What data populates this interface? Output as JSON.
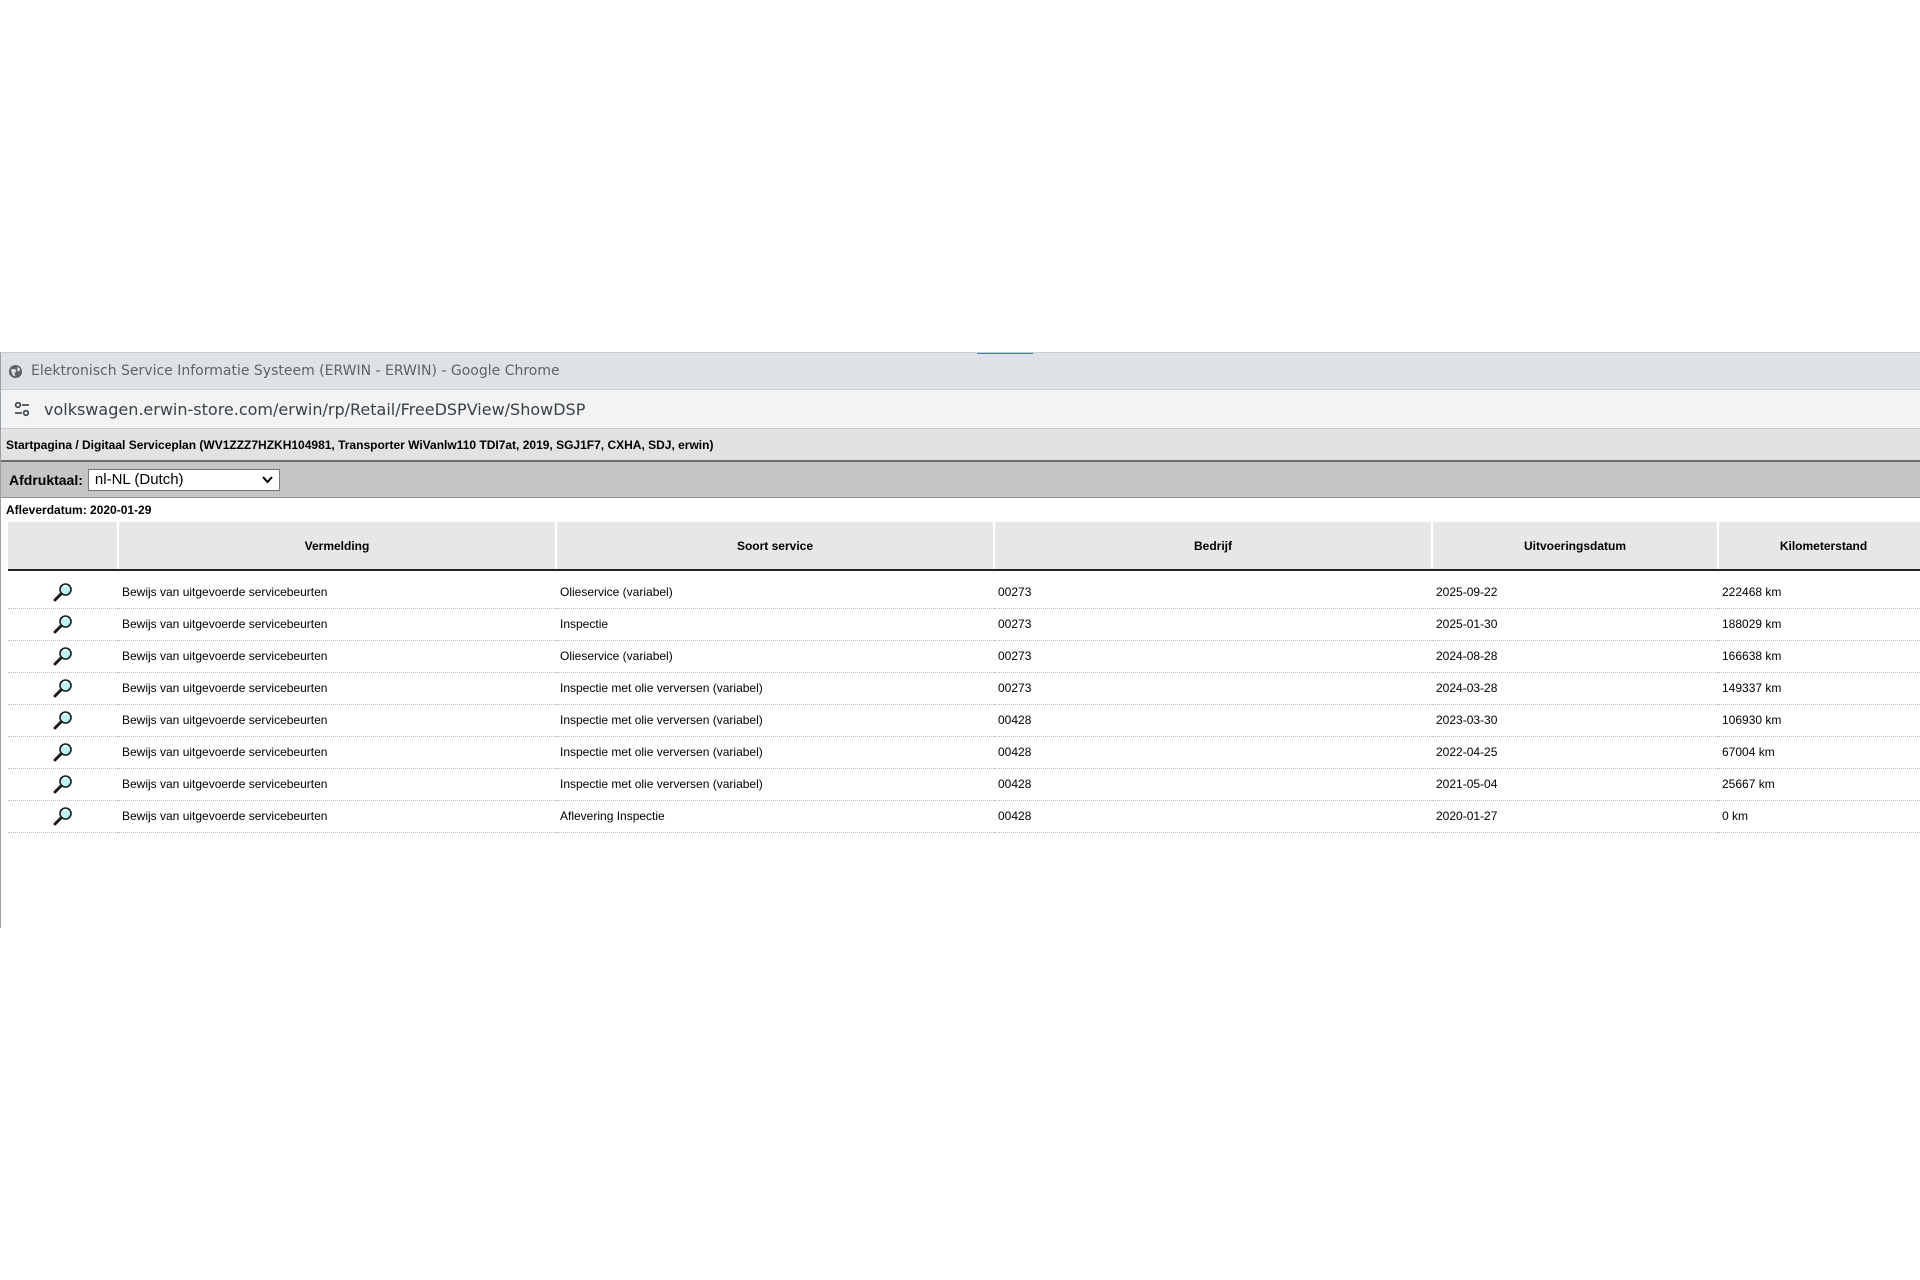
{
  "window": {
    "title": "Elektronisch Service Informatie Systeem (ERWIN - ERWIN) - Google Chrome",
    "url": "volkswagen.erwin-store.com/erwin/rp/Retail/FreeDSPView/ShowDSP",
    "app_icon": "globe-icon",
    "site_info_icon": "tune-icon"
  },
  "breadcrumb": "Startpagina / Digitaal Serviceplan (WV1ZZZ7HZKH104981, Transporter WiVanlw110 TDI7at, 2019, SGJ1F7, CXHA, SDJ, erwin)",
  "print_language": {
    "label": "Afdruktaal:",
    "selected": "nl-NL (Dutch)"
  },
  "delivery_date": "Afleverdatum: 2020-01-29",
  "table": {
    "headers": [
      "",
      "Vermelding",
      "Soort service",
      "Bedrijf",
      "Uitvoeringsdatum",
      "Kilometerstand"
    ],
    "row_icon": "magnifier-icon",
    "rows": [
      {
        "vermelding": "Bewijs van uitgevoerde servicebeurten",
        "soort": "Olieservice (variabel)",
        "bedrijf": "00273",
        "datum": "2025-09-22",
        "km": "222468 km"
      },
      {
        "vermelding": "Bewijs van uitgevoerde servicebeurten",
        "soort": "Inspectie",
        "bedrijf": "00273",
        "datum": "2025-01-30",
        "km": "188029 km"
      },
      {
        "vermelding": "Bewijs van uitgevoerde servicebeurten",
        "soort": "Olieservice (variabel)",
        "bedrijf": "00273",
        "datum": "2024-08-28",
        "km": "166638 km"
      },
      {
        "vermelding": "Bewijs van uitgevoerde servicebeurten",
        "soort": "Inspectie met olie verversen (variabel)",
        "bedrijf": "00273",
        "datum": "2024-03-28",
        "km": "149337 km"
      },
      {
        "vermelding": "Bewijs van uitgevoerde servicebeurten",
        "soort": "Inspectie met olie verversen (variabel)",
        "bedrijf": "00428",
        "datum": "2023-03-30",
        "km": "106930 km"
      },
      {
        "vermelding": "Bewijs van uitgevoerde servicebeurten",
        "soort": "Inspectie met olie verversen (variabel)",
        "bedrijf": "00428",
        "datum": "2022-04-25",
        "km": "67004 km"
      },
      {
        "vermelding": "Bewijs van uitgevoerde servicebeurten",
        "soort": "Inspectie met olie verversen (variabel)",
        "bedrijf": "00428",
        "datum": "2021-05-04",
        "km": "25667 km"
      },
      {
        "vermelding": "Bewijs van uitgevoerde servicebeurten",
        "soort": "Aflevering Inspectie",
        "bedrijf": "00428",
        "datum": "2020-01-27",
        "km": "0 km"
      }
    ]
  }
}
